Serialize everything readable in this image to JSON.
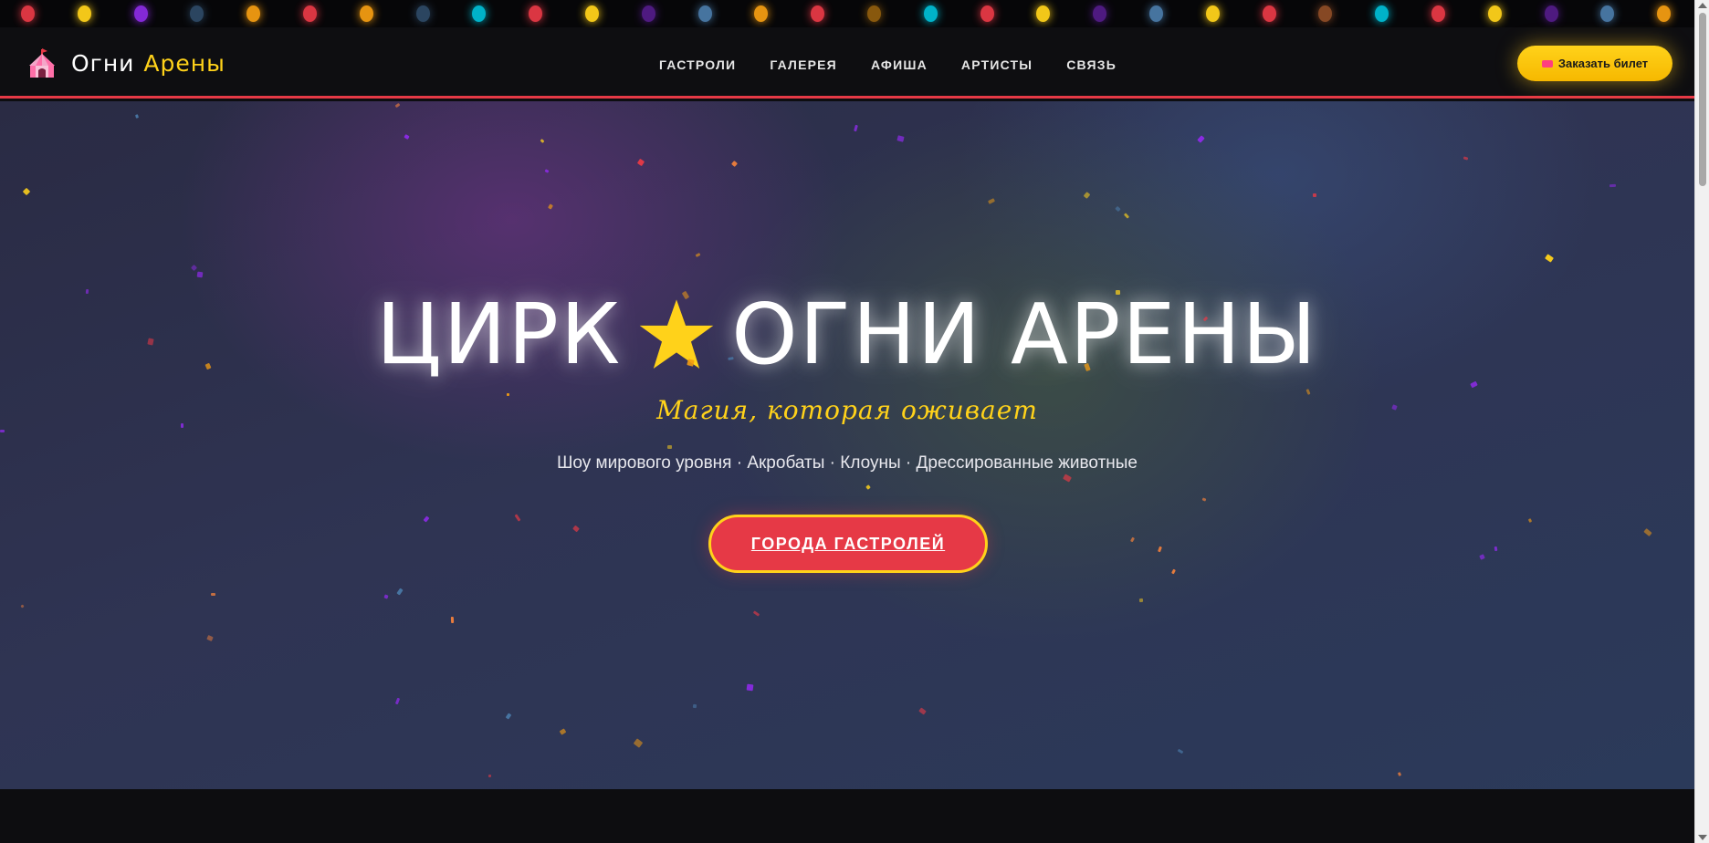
{
  "brand": {
    "name_part1": "Огни",
    "name_part2": "Арены",
    "logo_icon": "circus-tent-icon"
  },
  "nav": {
    "items": [
      {
        "label": "ГАСТРОЛИ"
      },
      {
        "label": "ГАЛЕРЕЯ"
      },
      {
        "label": "АФИША"
      },
      {
        "label": "АРТИСТЫ"
      },
      {
        "label": "СВЯЗЬ"
      }
    ]
  },
  "header": {
    "ticket_button_label": "Заказать билет",
    "ticket_icon": "ticket-icon"
  },
  "hero": {
    "title_left": "ЦИРК",
    "title_right": "ОГНИ АРЕНЫ",
    "title_icon": "star-icon",
    "tagline": "Магия, которая оживает",
    "subline": "Шоу мирового уровня · Акробаты · Клоуны · Дрессированные животные",
    "cta_label": "ГОРОДА ГАСТРОЛЕЙ"
  },
  "colors": {
    "accent_red": "#e63946",
    "accent_yellow": "#ffd21a",
    "header_bg": "#0e0e11",
    "light_colors": [
      "#e63946",
      "#ffd21a",
      "#8a2be2",
      "#4a7aa8",
      "#f39c12",
      "#00bcd4",
      "#f07f3c"
    ]
  }
}
